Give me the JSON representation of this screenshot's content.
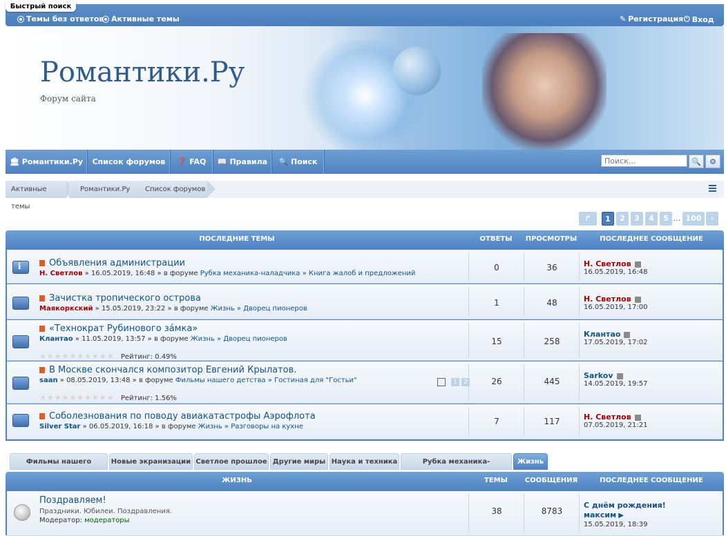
{
  "topbar": {
    "quick_search": "Быстрый поиск",
    "unanswered": "Темы без ответов",
    "active": "Активные темы",
    "register": "Регистрация",
    "login": "Вход"
  },
  "header": {
    "title": "Романтики.Ру",
    "subtitle": "Форум сайта"
  },
  "nav": {
    "home": "Романтики.Ру",
    "forums": "Список форумов",
    "faq": "FAQ",
    "rules": "Правила",
    "search": "Поиск",
    "search_placeholder": "Поиск…"
  },
  "breadcrumbs": [
    "Активные темы",
    "Романтики.Ру",
    "Список форумов"
  ],
  "pagination": {
    "pages": [
      "1",
      "2",
      "3",
      "4",
      "5"
    ],
    "ellipsis": "…",
    "last": "100",
    "current": "1"
  },
  "recent": {
    "headers": {
      "topics": "ПОСЛЕДНИЕ ТЕМЫ",
      "replies": "ОТВЕТЫ",
      "views": "ПРОСМОТРЫ",
      "last": "ПОСЛЕДНЕЕ СООБЩЕНИЕ"
    },
    "rows": [
      {
        "title": "Объявления администрации",
        "author": "Н. Светлов",
        "date": "» 16.05.2019, 16:48 » в форуме",
        "path": "Рубка механика-наладчика » Книга жалоб и предложений",
        "replies": "0",
        "views": "36",
        "last_author": "Н. Светлов",
        "last_date": "16.05.2019, 16:48"
      },
      {
        "title": "Зачистка тропического острова",
        "author": "Маякоркский",
        "date": "» 15.05.2019, 23:22 » в форуме",
        "path": "Жизнь » Дворец пионеров",
        "replies": "1",
        "views": "48",
        "last_author": "Н. Светлов",
        "last_date": "16.05.2019, 17:00"
      },
      {
        "title": "«Технократ Рубинового за́мка»",
        "author": "Клантао",
        "date": "» 11.05.2019, 13:57 » в форуме",
        "path": "Жизнь » Дворец пионеров",
        "rating": "Рейтинг: 0.49%",
        "replies": "15",
        "views": "258",
        "last_author": "Клантао",
        "last_date": "17.05.2019, 17:02"
      },
      {
        "title": "В Москве скончался композитор Евгений Крылатов.",
        "author": "saan",
        "date": "» 08.05.2019, 13:48 » в форуме",
        "path": "Фильмы нашего детства » Гостиная для \"Гостьи\"",
        "rating": "Рейтинг: 1.56%",
        "mini_pages": [
          "1",
          "2"
        ],
        "replies": "26",
        "views": "445",
        "last_author": "Sarkov",
        "last_date": "14.05.2019, 19:57"
      },
      {
        "title": "Соболезнования по поводу авиакатастрофы Аэрофлота",
        "author": "Silver Star",
        "date": "» 06.05.2019, 16:18 » в форуме",
        "path": "Жизнь » Разговоры на кухне",
        "replies": "7",
        "views": "117",
        "last_author": "Н. Светлов",
        "last_date": "07.05.2019, 21:21"
      }
    ]
  },
  "tabs": [
    "Фильмы нашего детства",
    "Новые экранизации",
    "Светлое прошлое",
    "Другие миры",
    "Наука и техника",
    "Рубка механика-наладчика",
    "Жизнь"
  ],
  "forum": {
    "headers": {
      "name": "ЖИЗНЬ",
      "topics": "ТЕМЫ",
      "posts": "СООБЩЕНИЯ",
      "last": "ПОСЛЕДНЕЕ СООБЩЕНИЕ"
    },
    "row": {
      "title": "Поздравляем!",
      "desc": "Праздники. Юбилеи. Поздравления.",
      "moderator_label": "Модератор:",
      "moderator": "модераторы",
      "topics": "38",
      "posts": "8783",
      "last_title": "С днём рождения!",
      "last_author": "максим",
      "last_date": "15.05.2019, 18:39"
    }
  }
}
